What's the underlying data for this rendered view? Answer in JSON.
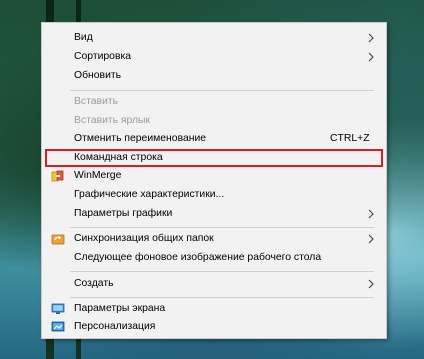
{
  "context_menu": {
    "view": "Вид",
    "sort": "Сортировка",
    "refresh": "Обновить",
    "paste": "Вставить",
    "paste_shortcut": "Вставить ярлык",
    "undo_rename": "Отменить переименование",
    "undo_rename_shortcut": "CTRL+Z",
    "command_prompt": "Командная строка",
    "winmerge": "WinMerge",
    "graphics_properties": "Графические характеристики...",
    "graphics_options": "Параметры графики",
    "sync_shared_folders": "Синхронизация общих папок",
    "next_background": "Следующее фоновое изображение рабочего стола",
    "new": "Создать",
    "display_settings": "Параметры экрана",
    "personalize": "Персонализация"
  },
  "colors": {
    "highlight_border": "#d41f2a",
    "menu_background": "#f2f2f2",
    "disabled_text": "#9b9b9b"
  },
  "icons": {
    "winmerge": "winmerge-icon",
    "sync": "sync-folders-icon",
    "display": "display-settings-icon",
    "personalize": "personalize-icon",
    "submenu": "chevron-right-icon"
  }
}
